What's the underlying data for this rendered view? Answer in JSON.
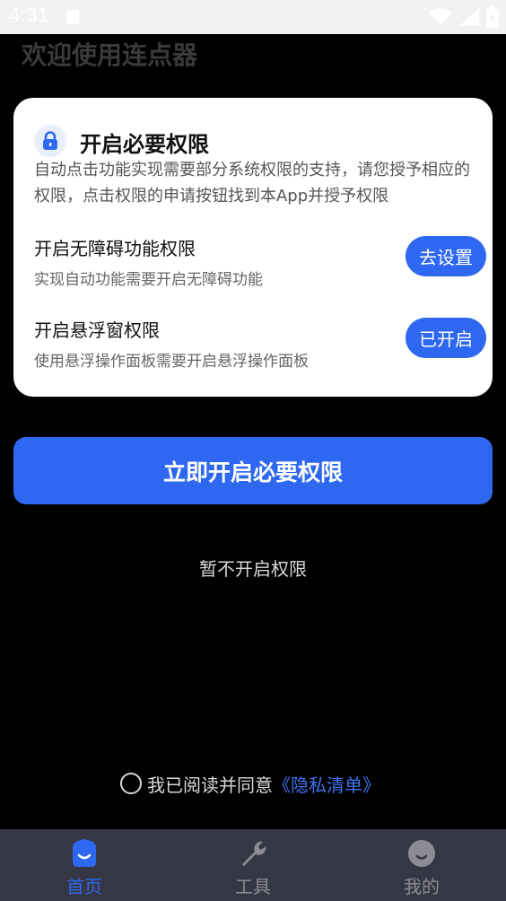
{
  "status_bar": {
    "time": "4:31"
  },
  "header": {
    "title": "欢迎使用连点器"
  },
  "card": {
    "title": "开启必要权限",
    "description": "自动点击功能实现需要部分系统权限的支持，请您授予相应的权限，点击权限的申请按钮找到本App并授予权限",
    "permissions": [
      {
        "title": "开启无障碍功能权限",
        "subtitle": "实现自动功能需要开启无障碍功能",
        "button": "去设置"
      },
      {
        "title": "开启悬浮窗权限",
        "subtitle": "使用悬浮操作面板需要开启悬浮操作面板",
        "button": "已开启"
      }
    ]
  },
  "primary_button": "立即开启必要权限",
  "skip_link": "暂不开启权限",
  "agreement": {
    "text": "我已阅读并同意",
    "link": "《隐私清单》"
  },
  "bottom_nav": [
    {
      "label": "首页",
      "icon": "home-icon",
      "active": true
    },
    {
      "label": "工具",
      "icon": "wrench-icon",
      "active": false
    },
    {
      "label": "我的",
      "icon": "profile-icon",
      "active": false
    }
  ],
  "colors": {
    "accent": "#2e68f0",
    "background": "#000000",
    "nav_bg": "#363744",
    "link": "#3d73f2"
  }
}
